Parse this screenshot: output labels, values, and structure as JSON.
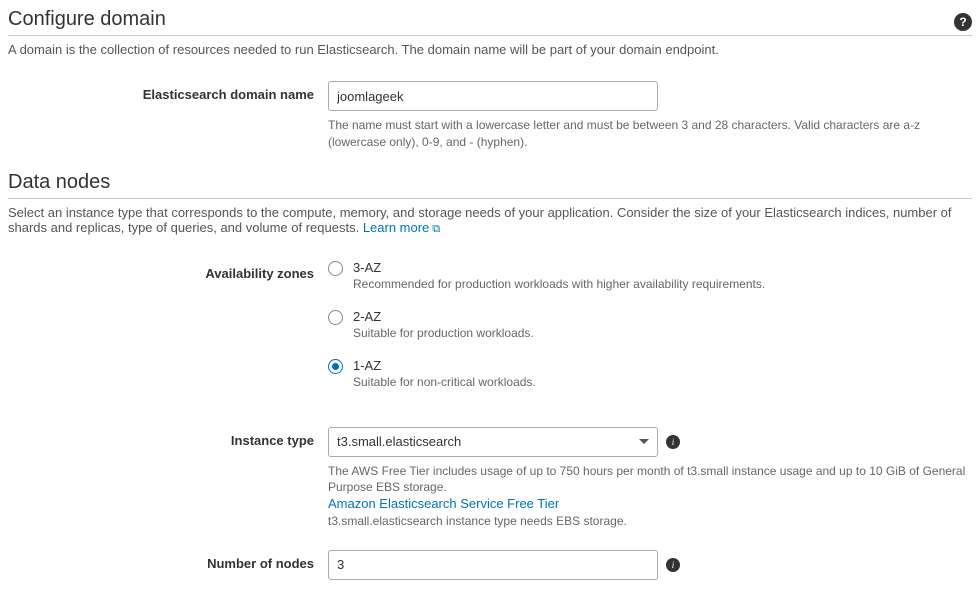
{
  "configureDomain": {
    "title": "Configure domain",
    "description": "A domain is the collection of resources needed to run Elasticsearch. The domain name will be part of your domain endpoint."
  },
  "domainName": {
    "label": "Elasticsearch domain name",
    "value": "joomlageek",
    "hint": "The name must start with a lowercase letter and must be between 3 and 28 characters. Valid characters are a-z (lowercase only), 0-9, and - (hyphen)."
  },
  "dataNodes": {
    "title": "Data nodes",
    "description": "Select an instance type that corresponds to the compute, memory, and storage needs of your application. Consider the size of your Elasticsearch indices, number of shards and replicas, type of queries, and volume of requests. ",
    "learnMore": "Learn more"
  },
  "availabilityZones": {
    "label": "Availability zones",
    "options": [
      {
        "label": "3-AZ",
        "hint": "Recommended for production workloads with higher availability requirements.",
        "selected": false
      },
      {
        "label": "2-AZ",
        "hint": "Suitable for production workloads.",
        "selected": false
      },
      {
        "label": "1-AZ",
        "hint": "Suitable for non-critical workloads.",
        "selected": true
      }
    ]
  },
  "instanceType": {
    "label": "Instance type",
    "value": "t3.small.elasticsearch",
    "hint1": "The AWS Free Tier includes usage of up to 750 hours per month of t3.small instance usage and up to 10 GiB of General Purpose EBS storage.",
    "freeTierLink": "Amazon Elasticsearch Service Free Tier",
    "hint2": "t3.small.elasticsearch instance type needs EBS storage."
  },
  "numberOfNodes": {
    "label": "Number of nodes",
    "value": "3"
  }
}
